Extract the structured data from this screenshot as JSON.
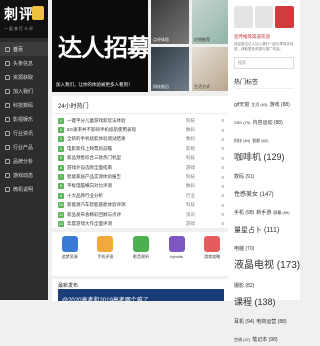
{
  "logo": {
    "text": "刺评",
    "sub": "一起来打卡评"
  },
  "sidebar": {
    "items": [
      {
        "label": "首页"
      },
      {
        "label": "头条信息"
      },
      {
        "label": "资源获取"
      },
      {
        "label": "加入我们"
      },
      {
        "label": "科技数码"
      },
      {
        "label": "影视娱乐"
      },
      {
        "label": "行业资讯"
      },
      {
        "label": "行业产品"
      },
      {
        "label": "品牌分析"
      },
      {
        "label": "游戏动态"
      },
      {
        "label": "微机说明"
      }
    ]
  },
  "hero": {
    "title": "达人招募",
    "caption": "加入我们，让你的体验被更多人看到！"
  },
  "thumbs": [
    {
      "caption": "点评体验"
    },
    {
      "caption": "好物推荐"
    },
    {
      "caption": "科技前沿"
    },
    {
      "caption": "生活方式"
    }
  ],
  "hot": {
    "title": "24小时热门",
    "items": [
      {
        "n": "1",
        "text": "一键平分儿童游戏新玩法体验",
        "tag": "科技",
        "count": "0"
      },
      {
        "n": "2",
        "text": "5G速率并不影响手机续航使用表现",
        "tag": "数码",
        "count": "0"
      },
      {
        "n": "3",
        "text": "全新的手机续航体验测试结果",
        "tag": "数码",
        "count": "0"
      },
      {
        "n": "4",
        "text": "电影新作上映票房前瞻",
        "tag": "影视",
        "count": "0"
      },
      {
        "n": "5",
        "text": "新品预售综合三款热门机型",
        "tag": "科技",
        "count": "0"
      },
      {
        "n": "6",
        "text": "游戏外设选购全面指南",
        "tag": "游戏",
        "count": "0"
      },
      {
        "n": "7",
        "text": "智能家居产品实测体验报告",
        "tag": "科技",
        "count": "0"
      },
      {
        "n": "8",
        "text": "平板电脑横向对比评测",
        "tag": "数码",
        "count": "0"
      },
      {
        "n": "9",
        "text": "十大品牌行业分析",
        "tag": "行业",
        "count": "0"
      },
      {
        "n": "10",
        "text": "新能源汽车智能座舱体验评测",
        "tag": "科技",
        "count": "0"
      },
      {
        "n": "11",
        "text": "新品发布会精彩回顾与点评",
        "tag": "资讯",
        "count": "0"
      },
      {
        "n": "12",
        "text": "年度游戏大作全面评测",
        "tag": "游戏",
        "count": "0"
      }
    ]
  },
  "apps": [
    {
      "label": "追梦资源",
      "color": "#3a7bd5"
    },
    {
      "label": "手机评测",
      "color": "#f2a93b"
    },
    {
      "label": "影音视听",
      "color": "#4caf50"
    },
    {
      "label": "hybrids",
      "color": "#7e57c2"
    },
    {
      "label": "游戏攻略",
      "color": "#e35d5d"
    }
  ],
  "latest": {
    "title": "最新发布",
    "card": "@2020高考和2019高考哪个难了"
  },
  "right": {
    "notice": "宣传推荐渠道欢迎",
    "body": "欢迎各位达人加入我们一起分享真实体验，获取更多资源与推广机会。",
    "search_placeholder": "搜索...",
    "tags_title": "热门标签",
    "tags": [
      {
        "label": "gif天窗",
        "size": 5
      },
      {
        "label": "生活 (63)",
        "size": 4
      },
      {
        "label": "游戏 (88)",
        "size": 5
      },
      {
        "label": "SSD (79)",
        "size": 4
      },
      {
        "label": "内容运动 (88)",
        "size": 5
      },
      {
        "label": "科技 (84)",
        "size": 4
      },
      {
        "label": "智能 (82)",
        "size": 4
      },
      {
        "label": "咖啡机 (129)",
        "size": 9
      },
      {
        "label": "数码 (91)",
        "size": 5
      },
      {
        "label": "性感美女 (147)",
        "size": 6
      },
      {
        "label": "手机 (98)",
        "size": 5
      },
      {
        "label": "新手游",
        "size": 5
      },
      {
        "label": "屏幕 (59)",
        "size": 4
      },
      {
        "label": "量星占卜 (111)",
        "size": 7
      },
      {
        "label": "电脑 (70)",
        "size": 5
      },
      {
        "label": "液晶电视 (173)",
        "size": 10
      },
      {
        "label": "摄影 (82)",
        "size": 5
      },
      {
        "label": "课程 (138)",
        "size": 9
      },
      {
        "label": "耳机 (94)",
        "size": 5
      },
      {
        "label": "电商运营 (88)",
        "size": 5
      },
      {
        "label": "空调 (47)",
        "size": 4
      },
      {
        "label": "笔记本 (98)",
        "size": 5
      }
    ]
  }
}
